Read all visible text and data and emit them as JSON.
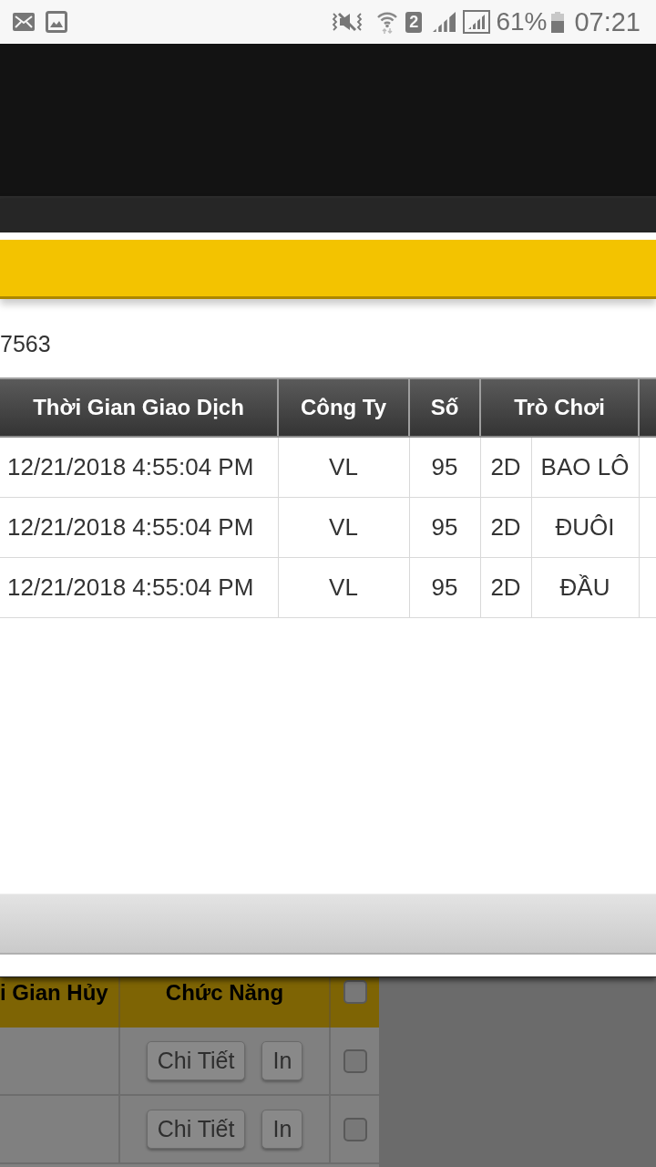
{
  "status_bar": {
    "sim_badge": "2",
    "battery": "61%",
    "time": "07:21"
  },
  "dialog": {
    "account_text": "7563",
    "table": {
      "columns": [
        {
          "label": "Thời Gian Giao Dịch"
        },
        {
          "label": "Công Ty"
        },
        {
          "label": "Số"
        },
        {
          "label": "Trò Chơi",
          "colspan": 2
        }
      ],
      "rows": [
        {
          "cells": [
            "12/21/2018 4:55:04 PM",
            "VL",
            "95",
            "2D",
            "BAO LÔ"
          ]
        },
        {
          "cells": [
            "12/21/2018 4:55:04 PM",
            "VL",
            "95",
            "2D",
            "ĐUÔI"
          ]
        },
        {
          "cells": [
            "12/21/2018 4:55:04 PM",
            "VL",
            "95",
            "2D",
            "ĐẦU"
          ]
        }
      ]
    }
  },
  "page_table": {
    "columns": [
      "i Gian Hủy",
      "Chức Năng"
    ],
    "select_all": {
      "checked": false
    },
    "rows": [
      {
        "actions": [
          "Chi Tiết",
          "In"
        ],
        "checked": false
      },
      {
        "actions": [
          "Chi Tiết",
          "In"
        ],
        "checked": false
      }
    ]
  }
}
